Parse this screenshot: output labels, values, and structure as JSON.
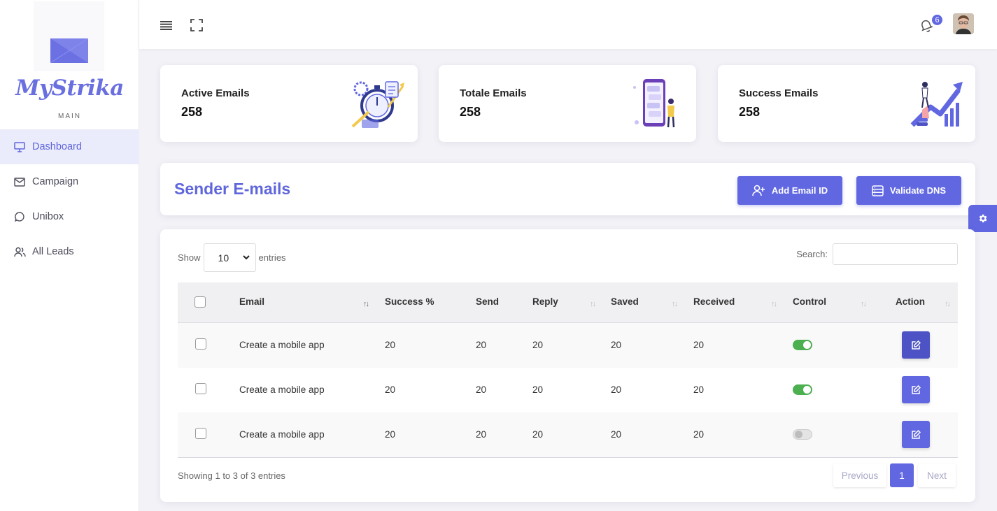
{
  "sidebar": {
    "brand": "MyStrika",
    "section_label": "MAIN",
    "items": [
      {
        "label": "Dashboard",
        "icon": "monitor-icon",
        "active": true
      },
      {
        "label": "Campaign",
        "icon": "mail-icon",
        "active": false
      },
      {
        "label": "Unibox",
        "icon": "chat-icon",
        "active": false
      },
      {
        "label": "All Leads",
        "icon": "users-icon",
        "active": false
      }
    ]
  },
  "topbar": {
    "notification_count": "6",
    "icons": [
      "menu-icon",
      "fullscreen-icon",
      "bell-icon",
      "avatar"
    ]
  },
  "stats": [
    {
      "label": "Active Emails",
      "value": "258",
      "icon": "stopwatch-illustration"
    },
    {
      "label": "Totale Emails",
      "value": "258",
      "icon": "phone-illustration"
    },
    {
      "label": "Success Emails",
      "value": "258",
      "icon": "growth-illustration"
    }
  ],
  "header": {
    "title": "Sender E-mails",
    "add_label": "Add Email ID",
    "validate_label": "Validate DNS"
  },
  "table": {
    "show_label": "Show",
    "entries_value": "10",
    "entries_label": "entries",
    "search_label": "Search:",
    "columns": [
      "Email",
      "Success %",
      "Send",
      "Reply",
      "Saved",
      "Received",
      "Control",
      "Action"
    ],
    "rows": [
      {
        "email": "Create a mobile app",
        "success": "20",
        "send": "20",
        "reply": "20",
        "saved": "20",
        "received": "20",
        "control": true
      },
      {
        "email": "Create a mobile app",
        "success": "20",
        "send": "20",
        "reply": "20",
        "saved": "20",
        "received": "20",
        "control": true
      },
      {
        "email": "Create a mobile app",
        "success": "20",
        "send": "20",
        "reply": "20",
        "saved": "20",
        "received": "20",
        "control": false
      }
    ],
    "info": "Showing 1 to 3 of 3 entries",
    "pagination": {
      "previous": "Previous",
      "current": "1",
      "next": "Next"
    }
  },
  "colors": {
    "accent": "#6167e0",
    "toggle_on": "#4caf50"
  }
}
